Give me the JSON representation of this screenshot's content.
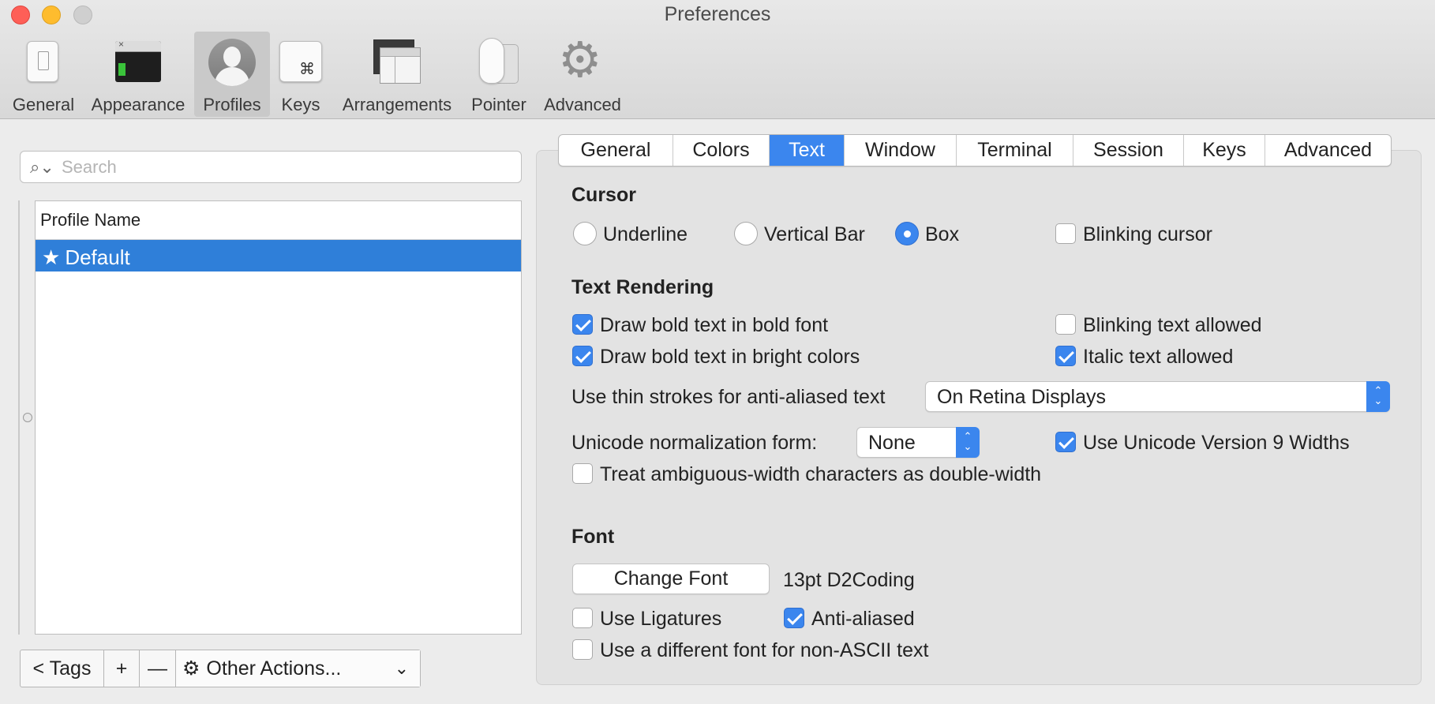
{
  "window": {
    "title": "Preferences"
  },
  "toolbar": {
    "items": [
      {
        "label": "General",
        "icon": "general-switch-icon"
      },
      {
        "label": "Appearance",
        "icon": "terminal-window-icon"
      },
      {
        "label": "Profiles",
        "icon": "user-silhouette-icon",
        "active": true
      },
      {
        "label": "Keys",
        "icon": "command-key-icon"
      },
      {
        "label": "Arrangements",
        "icon": "window-arrangement-icon"
      },
      {
        "label": "Pointer",
        "icon": "mouse-icon"
      },
      {
        "label": "Advanced",
        "icon": "gear-icon"
      }
    ]
  },
  "sidebar": {
    "search_placeholder": "Search",
    "table_header": "Profile Name",
    "profiles": [
      {
        "name": "Default",
        "default": true,
        "selected": true
      }
    ],
    "bottom": {
      "tags_label": "< Tags",
      "add_label": "+",
      "remove_label": "—",
      "actions_label": "Other Actions..."
    }
  },
  "tabs": {
    "items": [
      "General",
      "Colors",
      "Text",
      "Window",
      "Terminal",
      "Session",
      "Keys",
      "Advanced"
    ],
    "active": "Text"
  },
  "cursor": {
    "title": "Cursor",
    "options": [
      "Underline",
      "Vertical Bar",
      "Box"
    ],
    "selected": "Box",
    "blinking_label": "Blinking cursor",
    "blinking": false
  },
  "rendering": {
    "title": "Text Rendering",
    "bold_font_label": "Draw bold text in bold font",
    "bold_font": true,
    "bright_colors_label": "Draw bold text in bright colors",
    "bright_colors": true,
    "blinking_text_label": "Blinking text allowed",
    "blinking_text": false,
    "italic_label": "Italic text allowed",
    "italic": true,
    "thin_strokes_label": "Use thin strokes for anti-aliased text",
    "thin_strokes_value": "On Retina Displays",
    "unicode_norm_label": "Unicode normalization form:",
    "unicode_norm_value": "None",
    "unicode_widths_label": "Use Unicode Version 9 Widths",
    "unicode_widths": true,
    "ambiguous_label": "Treat ambiguous-width characters as double-width",
    "ambiguous": false
  },
  "font": {
    "title": "Font",
    "change_button": "Change Font",
    "current": "13pt D2Coding",
    "ligatures_label": "Use Ligatures",
    "ligatures": false,
    "antialiased_label": "Anti-aliased",
    "antialiased": true,
    "non_ascii_label": "Use a different font for non-ASCII text",
    "non_ascii": false
  },
  "colors": {
    "accent": "#3b86ee",
    "selection": "#2f7fd9"
  }
}
